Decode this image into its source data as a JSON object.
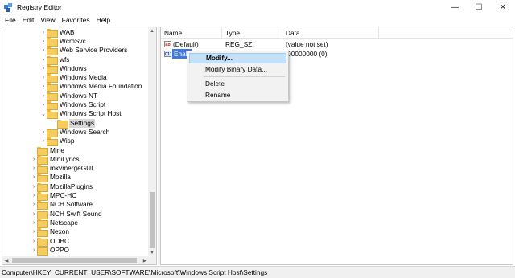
{
  "window": {
    "title": "Registry Editor",
    "minimize": "—",
    "maximize": "☐",
    "close": "✕"
  },
  "menu": [
    "File",
    "Edit",
    "View",
    "Favorites",
    "Help"
  ],
  "tree": [
    {
      "label": "WAB",
      "expander": "›",
      "indent": 1
    },
    {
      "label": "WcmSvc",
      "expander": "›",
      "indent": 1
    },
    {
      "label": "Web Service Providers",
      "expander": "›",
      "indent": 1
    },
    {
      "label": "wfs",
      "expander": "›",
      "indent": 1
    },
    {
      "label": "Windows",
      "expander": "›",
      "indent": 1
    },
    {
      "label": "Windows Media",
      "expander": "›",
      "indent": 1
    },
    {
      "label": "Windows Media Foundation",
      "expander": "›",
      "indent": 1
    },
    {
      "label": "Windows NT",
      "expander": "›",
      "indent": 1
    },
    {
      "label": "Windows Script",
      "expander": "›",
      "indent": 1
    },
    {
      "label": "Windows Script Host",
      "expander": "⌄",
      "indent": 1
    },
    {
      "label": "Settings",
      "expander": "",
      "indent": 2,
      "selected": true
    },
    {
      "label": "Windows Search",
      "expander": "›",
      "indent": 1
    },
    {
      "label": "Wisp",
      "expander": "›",
      "indent": 1
    },
    {
      "label": "Mine",
      "expander": "",
      "indent": 0
    },
    {
      "label": "MiniLyrics",
      "expander": "›",
      "indent": 0
    },
    {
      "label": "mkvmergeGUI",
      "expander": "›",
      "indent": 0
    },
    {
      "label": "Mozilla",
      "expander": "›",
      "indent": 0
    },
    {
      "label": "MozillaPlugins",
      "expander": "›",
      "indent": 0
    },
    {
      "label": "MPC-HC",
      "expander": "›",
      "indent": 0
    },
    {
      "label": "NCH Software",
      "expander": "›",
      "indent": 0
    },
    {
      "label": "NCH Swift Sound",
      "expander": "›",
      "indent": 0
    },
    {
      "label": "Netscape",
      "expander": "›",
      "indent": 0
    },
    {
      "label": "Nexon",
      "expander": "›",
      "indent": 0
    },
    {
      "label": "ODBC",
      "expander": "›",
      "indent": 0
    },
    {
      "label": "OPPO",
      "expander": "›",
      "indent": 0
    }
  ],
  "list": {
    "headers": {
      "name": "Name",
      "type": "Type",
      "data": "Data"
    },
    "rows": [
      {
        "name": "(Default)",
        "type": "REG_SZ",
        "data": "(value not set)",
        "icon": "ab"
      },
      {
        "name": "Enabl",
        "type": "",
        "data": "x00000000 (0)",
        "icon": "011"
      }
    ]
  },
  "context_menu": {
    "items": [
      "Modify...",
      "Modify Binary Data...",
      "Delete",
      "Rename"
    ]
  },
  "status": "Computer\\HKEY_CURRENT_USER\\SOFTWARE\\Microsoft\\Windows Script Host\\Settings",
  "scroll": {
    "up": "▲",
    "down": "▼",
    "left": "◀",
    "right": "▶"
  }
}
